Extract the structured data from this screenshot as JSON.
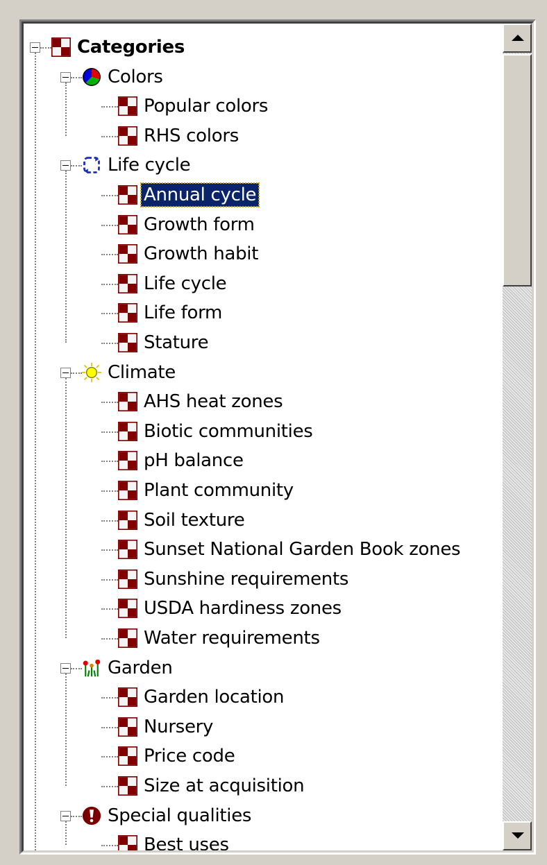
{
  "tree": {
    "root": {
      "label": "Categories",
      "icon": "category-icon"
    },
    "groups": [
      {
        "label": "Colors",
        "icon": "pie-chart-icon",
        "items": [
          "Popular colors",
          "RHS colors"
        ]
      },
      {
        "label": "Life cycle",
        "icon": "cycle-arrows-icon",
        "items": [
          "Annual cycle",
          "Growth form",
          "Growth habit",
          "Life cycle",
          "Life form",
          "Stature"
        ]
      },
      {
        "label": "Climate",
        "icon": "sun-icon",
        "items": [
          "AHS heat zones",
          "Biotic communities",
          "pH balance",
          "Plant community",
          "Soil texture",
          "Sunset National Garden Book zones",
          "Sunshine requirements",
          "USDA hardiness zones",
          "Water requirements"
        ]
      },
      {
        "label": "Garden",
        "icon": "flowers-icon",
        "items": [
          "Garden location",
          "Nursery",
          "Price code",
          "Size at acquisition"
        ]
      },
      {
        "label": "Special qualities",
        "icon": "exclamation-icon",
        "items": [
          "Best uses"
        ]
      }
    ],
    "selected": "Annual cycle"
  },
  "colors": {
    "selection_bg": "#0a246a",
    "category_icon": "#800000"
  }
}
